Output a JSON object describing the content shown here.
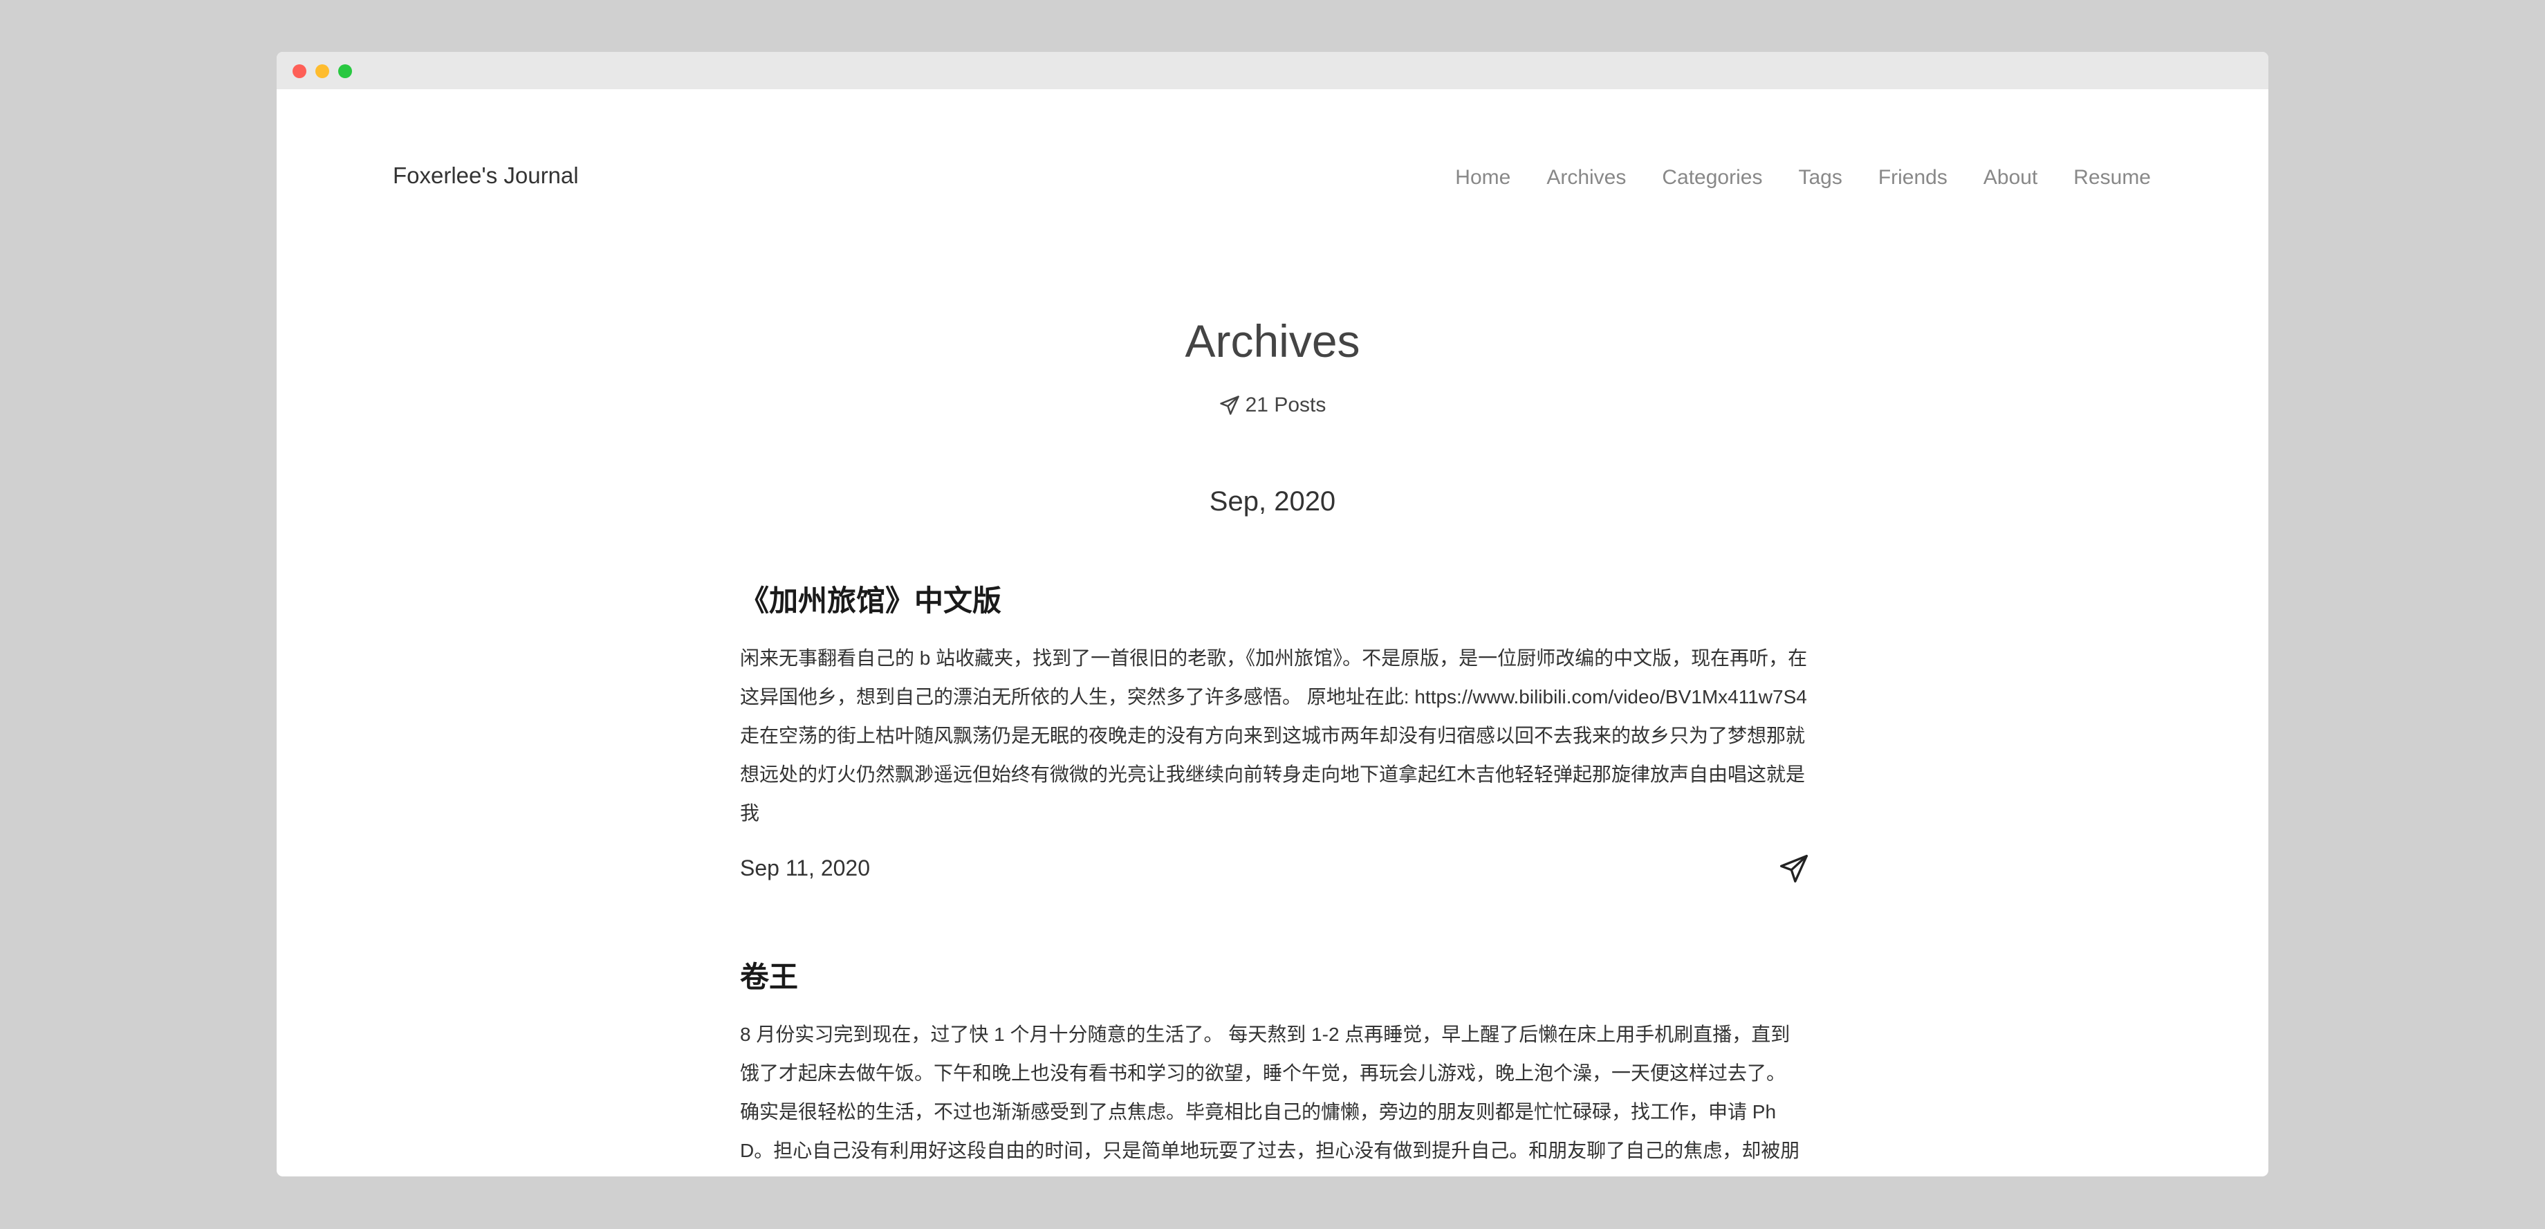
{
  "site": {
    "title": "Foxerlee's Journal"
  },
  "nav": {
    "items": [
      "Home",
      "Archives",
      "Categories",
      "Tags",
      "Friends",
      "About",
      "Resume"
    ]
  },
  "page": {
    "title": "Archives",
    "post_count": "21 Posts",
    "post_count_icon": "paper-plane-icon"
  },
  "archive": {
    "month": "Sep, 2020",
    "posts": [
      {
        "title": "《加州旅馆》中文版",
        "excerpt": "闲来无事翻看自己的 b 站收藏夹，找到了一首很旧的老歌，《加州旅馆》。不是原版，是一位厨师改编的中文版，现在再听，在这异国他乡，想到自己的漂泊无所依的人生，突然多了许多感悟。 原地址在此: https://www.bilibili.com/video/BV1Mx411w7S4 走在空荡的街上枯叶随风飘荡仍是无眠的夜晚走的没有方向来到这城市两年却没有归宿感以回不去我来的故乡只为了梦想那就想远处的灯火仍然飘渺遥远但始终有微微的光亮让我继续向前转身走向地下道拿起红木吉他轻轻弹起那旋律放声自由唱这就是我",
        "date": "Sep 11, 2020",
        "share_icon": "paper-plane-icon"
      },
      {
        "title": "卷王",
        "excerpt": "8 月份实习完到现在，过了快 1 个月十分随意的生活了。 每天熬到 1-2 点再睡觉，早上醒了后懒在床上用手机刷直播，直到饿了才起床去做午饭。下午和晚上也没有看书和学习的欲望，睡个午觉，再玩会儿游戏，晚上泡个澡，一天便这样过去了。 确实是很轻松的生活，不过也渐渐感受到了点焦虑。毕竟相比自己的慵懒，旁边的朋友则都是忙忙碌碌，找工作，申请 PhD。担心自己没有利用好这段自由的时间，只是简单地玩耍了过去，担心没有做到提升自己。和朋友聊了自己的焦虑，却被朋友批评道，“你这是卷王的心态”，既然现在没什"
      }
    ]
  }
}
